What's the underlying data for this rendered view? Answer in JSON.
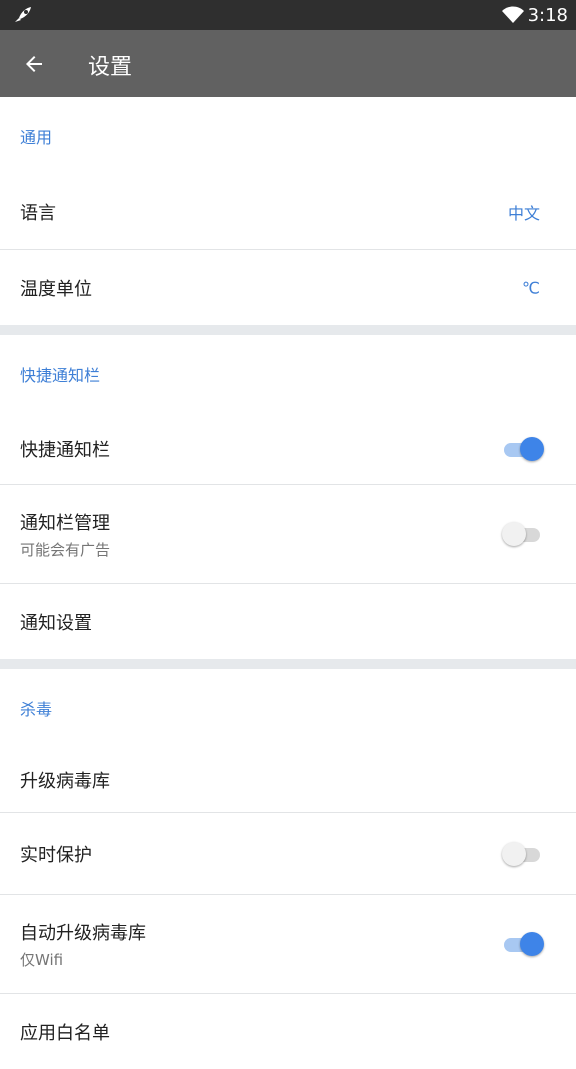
{
  "status_bar": {
    "time": "3:18"
  },
  "app_bar": {
    "title": "设置"
  },
  "sections": {
    "general": {
      "header": "通用",
      "language": {
        "label": "语言",
        "value": "中文"
      },
      "temperature": {
        "label": "温度单位",
        "value": "℃"
      }
    },
    "notification": {
      "header": "快捷通知栏",
      "quick_bar": {
        "label": "快捷通知栏",
        "enabled": true
      },
      "bar_manage": {
        "label": "通知栏管理",
        "subtitle": "可能会有广告",
        "enabled": false
      },
      "settings": {
        "label": "通知设置"
      }
    },
    "antivirus": {
      "header": "杀毒",
      "update_db": {
        "label": "升级病毒库"
      },
      "realtime": {
        "label": "实时保护",
        "enabled": false
      },
      "auto_update": {
        "label": "自动升级病毒库",
        "subtitle": "仅Wifi",
        "enabled": true
      },
      "whitelist": {
        "label": "应用白名单"
      }
    }
  },
  "colors": {
    "accent": "#3e7fd6",
    "app_bar": "#616161",
    "status_bar": "#2f2f2f"
  }
}
